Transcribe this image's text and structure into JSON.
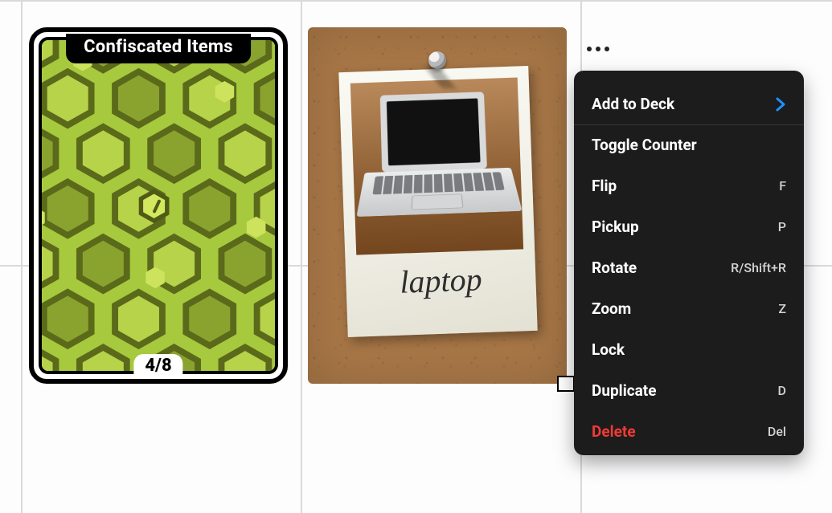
{
  "deck": {
    "title": "Confiscated Items",
    "counter": "4/8"
  },
  "photo": {
    "caption": "laptop"
  },
  "menu": {
    "add_to_deck": "Add to Deck",
    "toggle_counter": "Toggle Counter",
    "flip": {
      "label": "Flip",
      "shortcut": "F"
    },
    "pickup": {
      "label": "Pickup",
      "shortcut": "P"
    },
    "rotate": {
      "label": "Rotate",
      "shortcut": "R/Shift+R"
    },
    "zoom": {
      "label": "Zoom",
      "shortcut": "Z"
    },
    "lock": {
      "label": "Lock"
    },
    "duplicate": {
      "label": "Duplicate",
      "shortcut": "D"
    },
    "delete": {
      "label": "Delete",
      "shortcut": "Del"
    }
  }
}
